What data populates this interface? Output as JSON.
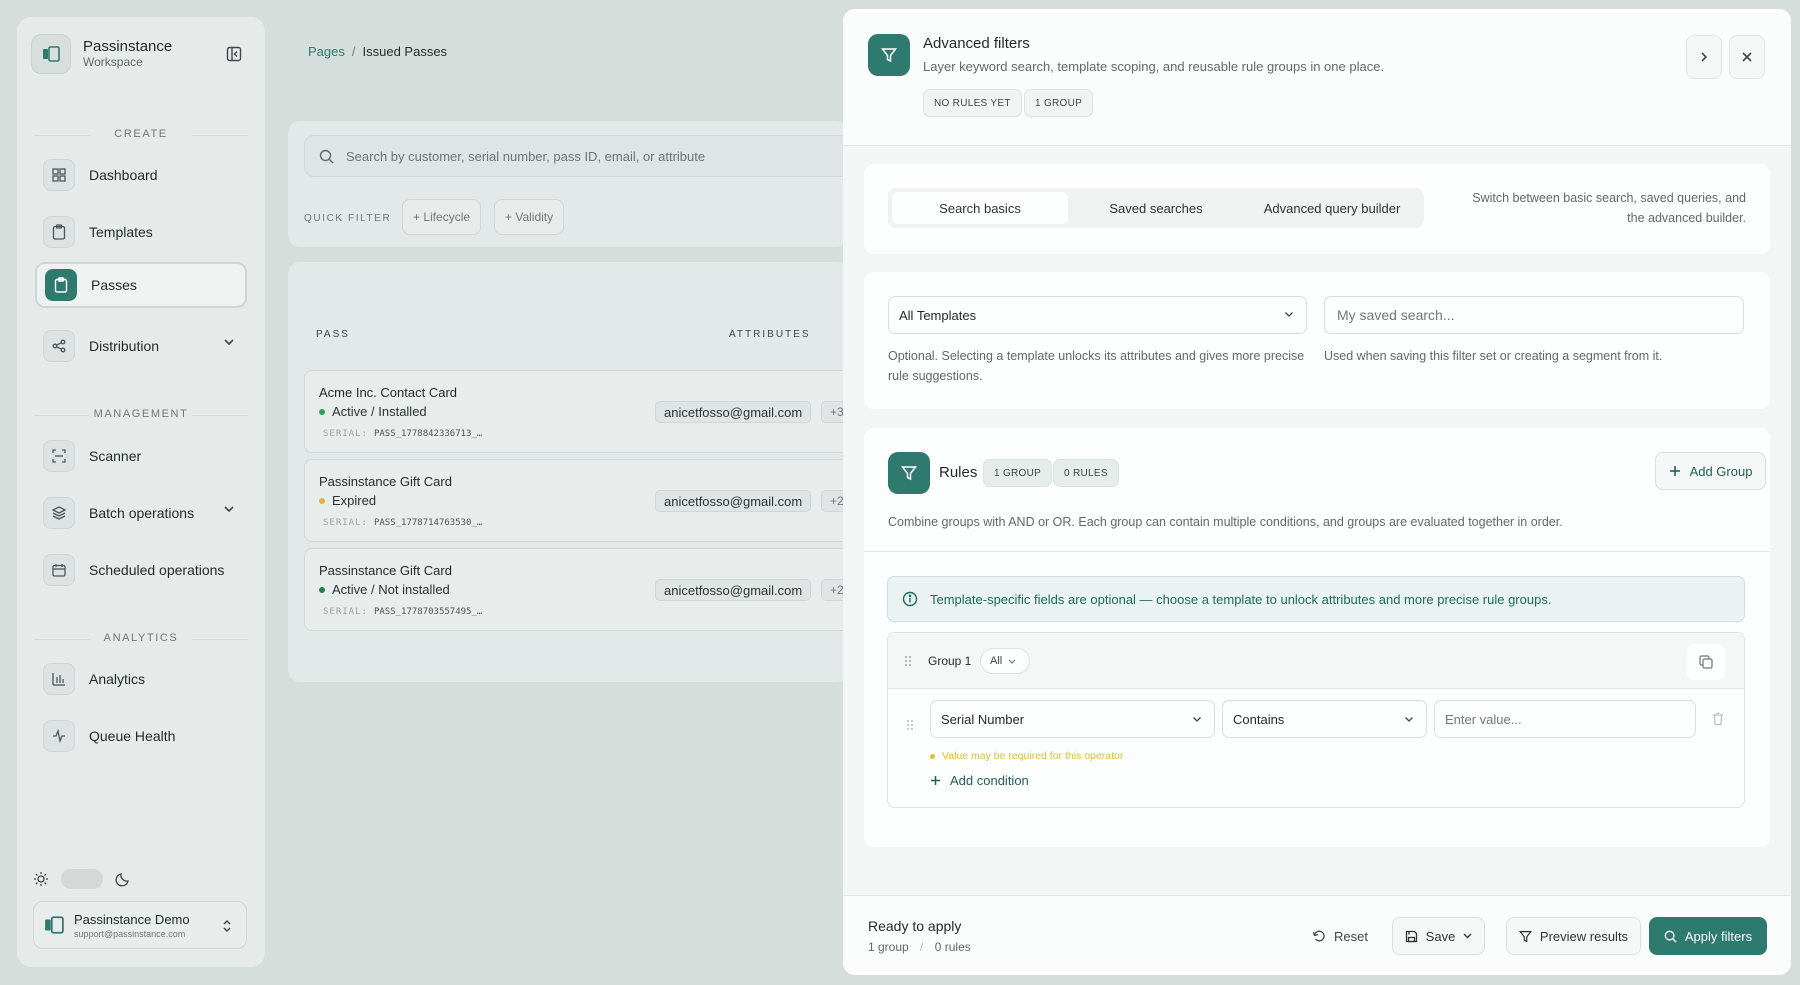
{
  "sidebar": {
    "brand_name": "Passinstance",
    "brand_sub": "Workspace",
    "sections": {
      "create": "CREATE",
      "management": "MANAGEMENT",
      "analytics": "ANALYTICS"
    },
    "items": {
      "dashboard": "Dashboard",
      "templates": "Templates",
      "passes": "Passes",
      "distribution": "Distribution",
      "scanner": "Scanner",
      "batch": "Batch operations",
      "scheduled": "Scheduled operations",
      "analytics": "Analytics",
      "queue": "Queue Health"
    },
    "account_name": "Passinstance Demo",
    "account_email": "support@passinstance.com"
  },
  "breadcrumb": {
    "root": "Pages",
    "sep": "/",
    "current": "Issued Passes"
  },
  "search": {
    "placeholder": "Search by customer, serial number, pass ID, email, or attribute",
    "quick_filter_label": "QUICK FILTER",
    "chip_lifecycle": "+ Lifecycle",
    "chip_validity": "+ Validity"
  },
  "table": {
    "col_pass": "PASS",
    "col_attributes": "ATTRIBUTES",
    "serial_label": "SERIAL:",
    "rows": [
      {
        "name": "Acme Inc. Contact Card",
        "status": "Active / Installed",
        "status_color": "#2e9e5b",
        "serial": "PASS_1778842336713_…",
        "attr": "anicetfosso@gmail.com",
        "more": "+3"
      },
      {
        "name": "Passinstance Gift Card",
        "status": "Expired",
        "status_color": "#e0b63a",
        "serial": "PASS_1778714763530_…",
        "attr": "anicetfosso@gmail.com",
        "more": "+2"
      },
      {
        "name": "Passinstance Gift Card",
        "status": "Active / Not installed",
        "status_color": "#2e7a4f",
        "serial": "PASS_1778703557495_…",
        "attr": "anicetfosso@gmail.com",
        "more": "+2"
      }
    ]
  },
  "panel": {
    "title": "Advanced filters",
    "subtitle": "Layer keyword search, template scoping, and reusable rule groups in one place.",
    "badge_rules": "NO RULES YET",
    "badge_group": "1 GROUP",
    "tabs": {
      "basics": "Search basics",
      "saved": "Saved searches",
      "advanced": "Advanced query builder"
    },
    "tabs_note": "Switch between basic search, saved queries, and the advanced builder.",
    "template_select": "All Templates",
    "template_hint": "Optional. Selecting a template unlocks its attributes and gives more precise rule suggestions.",
    "name_placeholder": "My saved search...",
    "name_hint": "Used when saving this filter set or creating a segment from it.",
    "rules_title": "Rules",
    "rules_badge_group": "1 GROUP",
    "rules_badge_rules": "0 RULES",
    "add_group": "Add Group",
    "rules_desc": "Combine groups with AND or OR. Each group can contain multiple conditions, and groups are evaluated together in order.",
    "info_text": "Template-specific fields are optional — choose a template to unlock attributes and more precise rule groups.",
    "group_label": "Group 1",
    "group_mode": "All",
    "field_select": "Serial Number",
    "operator_select": "Contains",
    "value_placeholder": "Enter value...",
    "warning": "Value may be required for this operator",
    "add_condition": "Add condition",
    "footer_status": "Ready to apply",
    "footer_groups": "1 group",
    "footer_sep": "/",
    "footer_rules": "0 rules",
    "reset": "Reset",
    "save": "Save",
    "preview": "Preview results",
    "apply": "Apply filters"
  },
  "colors": {
    "accent": "#2f7a6f",
    "warning": "#e0c030"
  }
}
